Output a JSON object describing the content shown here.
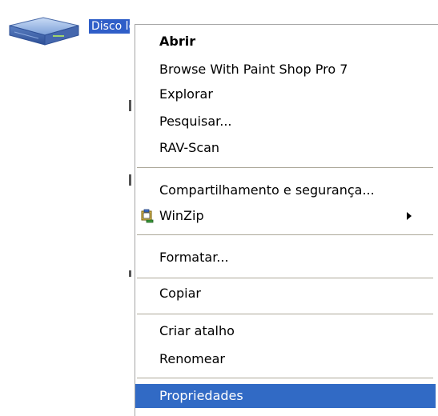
{
  "desktop": {
    "drive_label": "Disco local (C:)"
  },
  "menu": {
    "open": "Abrir",
    "browse_psp": "Browse With Paint Shop Pro 7",
    "explore": "Explorar",
    "search": "Pesquisar...",
    "rav_scan": "RAV-Scan",
    "sharing": "Compartilhamento e segurança...",
    "winzip": "WinZip",
    "format": "Formatar...",
    "copy": "Copiar",
    "create_shortcut": "Criar atalho",
    "rename": "Renomear",
    "properties": "Propriedades"
  },
  "colors": {
    "selection": "#316ac5",
    "separator": "#aca899"
  },
  "icons": {
    "drive": "hard-drive-icon",
    "winzip": "winzip-icon",
    "submenu": "submenu-arrow-icon"
  }
}
